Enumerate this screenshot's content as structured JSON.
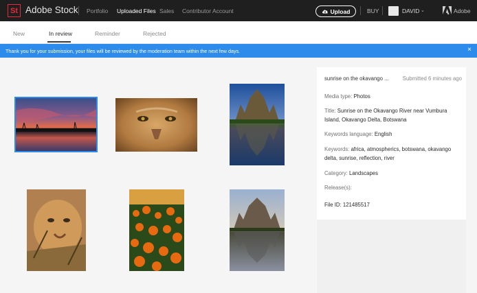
{
  "app": {
    "brand_mark": "St",
    "brand": "Adobe Stock",
    "nav": [
      "Portfolio",
      "Uploaded Files",
      "Sales",
      "Contributor Account"
    ],
    "upload_label": "Upload",
    "buy_label": "BUY",
    "user_name": "DAVID",
    "adobe_label": "Adobe"
  },
  "tabs": [
    "New",
    "In review",
    "Reminder",
    "Rejected"
  ],
  "banner": {
    "message": "Thank you for your submission, your files will be reviewed by the moderation team within the next few days.",
    "close": "×"
  },
  "details": {
    "name": "sunrise on the okavango ...",
    "submitted": "Submitted 6 minutes ago",
    "media_type_label": "Media type:",
    "media_type": "Photos",
    "title_label": "Title:",
    "title": "Sunrise on the Okavango River near Vumbura Island, Okavango Delta, Botswana",
    "keywords_language_label": "Keywords language:",
    "keywords_language": "English",
    "keywords_label": "Keywords:",
    "keywords": "africa, atmospherics, botswana, okavango delta, sunrise, reflection, river",
    "category_label": "Category:",
    "category": "Landscapes",
    "releases_label": "Release(s):",
    "file_id_label": "File ID:",
    "file_id": "121485517"
  },
  "colors": {
    "topbar": "#1f1f1f",
    "accent": "#2d8ceb",
    "brand_red": "#ea2a3b"
  }
}
